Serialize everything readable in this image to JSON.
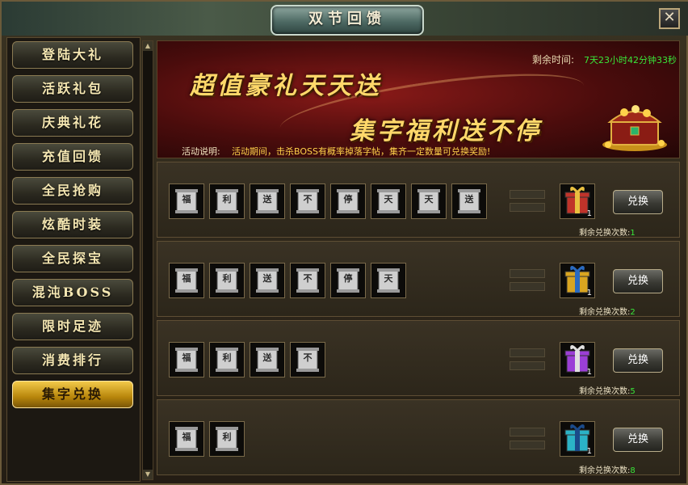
{
  "window": {
    "title": "双节回馈",
    "close_label": "✕"
  },
  "sidebar": {
    "items": [
      {
        "label": "登陆大礼"
      },
      {
        "label": "活跃礼包"
      },
      {
        "label": "庆典礼花"
      },
      {
        "label": "充值回馈"
      },
      {
        "label": "全民抢购"
      },
      {
        "label": "炫酷时装"
      },
      {
        "label": "全民探宝"
      },
      {
        "label": "混沌BOSS"
      },
      {
        "label": "限时足迹"
      },
      {
        "label": "消费排行"
      },
      {
        "label": "集字兑换",
        "active": true
      }
    ]
  },
  "banner": {
    "timer_label": "剩余时间:",
    "timer_value": "7天23小时42分钟33秒",
    "slogan1": "超值豪礼天天送",
    "slogan2": "集字福利送不停",
    "desc_label": "活动说明:",
    "desc_text": "活动期间，击杀BOSS有概率掉落字帖，集齐一定数量可兑换奖励!"
  },
  "exchange_rows": [
    {
      "chars": [
        "福",
        "利",
        "送",
        "不",
        "停",
        "天",
        "天",
        "送"
      ],
      "reward_count": "1",
      "button": "兑换",
      "remain_label": "剩余兑换次数:",
      "remain_value": "1",
      "gift_color": "#c0332a"
    },
    {
      "chars": [
        "福",
        "利",
        "送",
        "不",
        "停",
        "天"
      ],
      "reward_count": "1",
      "button": "兑换",
      "remain_label": "剩余兑换次数:",
      "remain_value": "2",
      "gift_color": "#d9a520"
    },
    {
      "chars": [
        "福",
        "利",
        "送",
        "不"
      ],
      "reward_count": "1",
      "button": "兑换",
      "remain_label": "剩余兑换次数:",
      "remain_value": "5",
      "gift_color": "#9b3fd6"
    },
    {
      "chars": [
        "福",
        "利"
      ],
      "reward_count": "1",
      "button": "兑换",
      "remain_label": "剩余兑换次数:",
      "remain_value": "8",
      "gift_color": "#2bb3c6"
    }
  ],
  "colors": {
    "accent_gold": "#f2c94a",
    "timer_green": "#39e639"
  }
}
